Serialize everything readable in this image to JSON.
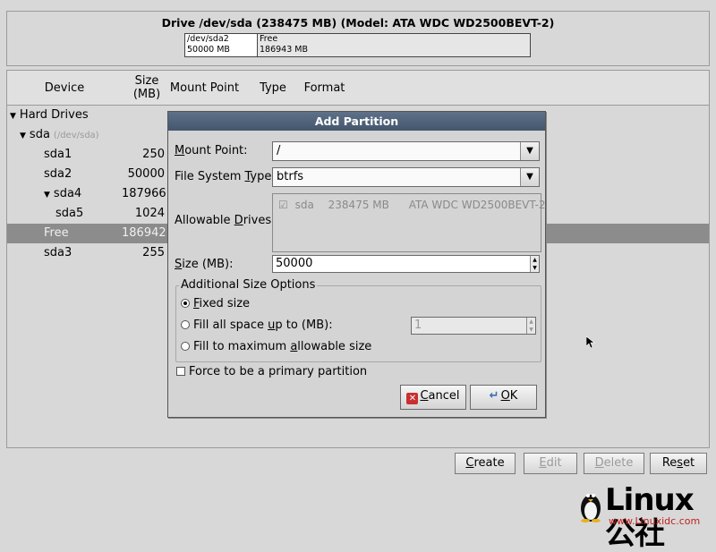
{
  "drive": {
    "title": "Drive /dev/sda (238475 MB) (Model: ATA WDC WD2500BEVT-2)",
    "map": [
      {
        "name": "/dev/sda2",
        "size": "50000 MB"
      },
      {
        "name": "Free",
        "size": "186943 MB"
      }
    ]
  },
  "table": {
    "headers": [
      "Device",
      "Size (MB)",
      "Mount Point",
      "Type",
      "Format"
    ],
    "rows": [
      {
        "device": "Hard Drives",
        "size": "",
        "level": 0,
        "expander": "▼",
        "sub": ""
      },
      {
        "device": "sda",
        "size": "",
        "level": 1,
        "expander": "▼",
        "sub": "(/dev/sda)"
      },
      {
        "device": "sda1",
        "size": "250",
        "level": 2,
        "expander": "",
        "sub": ""
      },
      {
        "device": "sda2",
        "size": "50000",
        "level": 2,
        "expander": "",
        "sub": ""
      },
      {
        "device": "sda4",
        "size": "187966",
        "level": 2,
        "expander": "▼",
        "sub": ""
      },
      {
        "device": "sda5",
        "size": "1024",
        "level": 3,
        "expander": "",
        "sub": ""
      },
      {
        "device": "Free",
        "size": "186942",
        "level": 2,
        "expander": "",
        "sub": "",
        "selected": true
      },
      {
        "device": "sda3",
        "size": "255",
        "level": 2,
        "expander": "",
        "sub": ""
      }
    ]
  },
  "buttons": {
    "create": {
      "pre": "",
      "key": "C",
      "post": "reate"
    },
    "edit": {
      "pre": "",
      "key": "E",
      "post": "dit"
    },
    "delete": {
      "pre": "",
      "key": "D",
      "post": "elete"
    },
    "reset": {
      "pre": "Re",
      "key": "s",
      "post": "et"
    }
  },
  "dialog": {
    "title": "Add Partition",
    "mount_label": {
      "pre": "",
      "key": "M",
      "post": "ount Point:"
    },
    "mount_value": "/",
    "fs_label": {
      "pre": "File System ",
      "key": "T",
      "post": "ype:"
    },
    "fs_value": "btrfs",
    "drives_label": {
      "pre": "Allowable ",
      "key": "D",
      "post": "rives:"
    },
    "drive_entry": {
      "name": "sda",
      "size": "238475 MB",
      "model": "ATA WDC WD2500BEVT-2"
    },
    "size_label": {
      "pre": "",
      "key": "S",
      "post": "ize (MB):"
    },
    "size_value": "50000",
    "options_legend": "Additional Size Options",
    "opt_fixed": {
      "pre": "",
      "key": "F",
      "post": "ixed size"
    },
    "opt_fill_upto": {
      "pre": "Fill all space ",
      "key": "u",
      "post": "p to (MB):"
    },
    "fill_upto_value": "1",
    "opt_fill_max": {
      "pre": "Fill to maximum ",
      "key": "a",
      "post": "llowable size"
    },
    "primary_label": "Force to be a primary partition",
    "cancel": {
      "pre": "",
      "key": "C",
      "post": "ancel"
    },
    "ok": {
      "pre": "",
      "key": "O",
      "post": "K"
    }
  },
  "watermark": {
    "brand": "Linux公社",
    "url": "www.Linuxidc.com"
  },
  "colors": {
    "title_bar": "#4d6079",
    "selected_row": "#8c8c8c",
    "cancel_icon": "#c83030",
    "ok_icon": "#3d6fb5"
  }
}
